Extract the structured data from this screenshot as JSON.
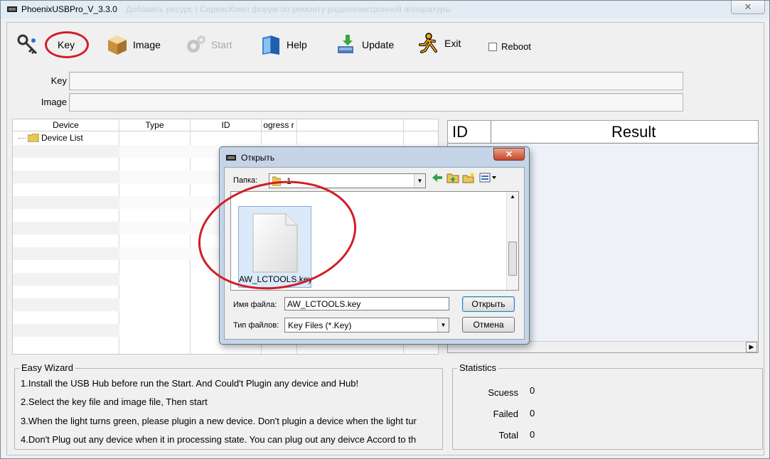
{
  "window": {
    "title": "PhoenixUSBPro_V_3.3.0",
    "background_title": "Добавить ресурс | СервисКомп форум по ремонту радиоэлектронной аппаратуры",
    "close_label": "✕"
  },
  "toolbar": {
    "key_label": "Key",
    "image_label": "Image",
    "start_label": "Start",
    "help_label": "Help",
    "update_label": "Update",
    "exit_label": "Exit",
    "reboot_label": "Reboot",
    "reboot_checked": false
  },
  "fields": {
    "key_label": "Key",
    "key_value": "",
    "image_label": "Image",
    "image_value": ""
  },
  "device_table": {
    "columns": [
      "Device",
      "Type",
      "ID",
      "ogress r"
    ],
    "tree_root": "Device List"
  },
  "result_table": {
    "columns": [
      "ID",
      "Result"
    ]
  },
  "wizard": {
    "title": "Easy Wizard",
    "lines": [
      "1.Install the USB Hub before run the Start. And Could't Plugin any device and Hub!",
      "2.Select the key file and image file, Then start",
      "3.When the light turns green, please plugin a new device. Don't plugin a device when the light tur",
      "4.Don't Plug out any device when it in processing state. You can plug out any deivce Accord to th"
    ]
  },
  "statistics": {
    "title": "Statistics",
    "success_label": "Scuess",
    "success_value": "0",
    "failed_label": "Failed",
    "failed_value": "0",
    "total_label": "Total",
    "total_value": "0"
  },
  "dialog": {
    "title": "Открыть",
    "close_label": "✕",
    "folder_label": "Папка:",
    "folder_value": "1",
    "file": {
      "name": "AW_LCTOOLS.key"
    },
    "filename_label": "Имя файла:",
    "filename_value": "AW_LCTOOLS.key",
    "filetype_label": "Тип файлов:",
    "filetype_value": "Key Files (*.Key)",
    "open_button": "Открыть",
    "cancel_button": "Отмена"
  },
  "colors": {
    "annotation_red": "#d21c25",
    "selection_blue": "#dbeaf9"
  }
}
